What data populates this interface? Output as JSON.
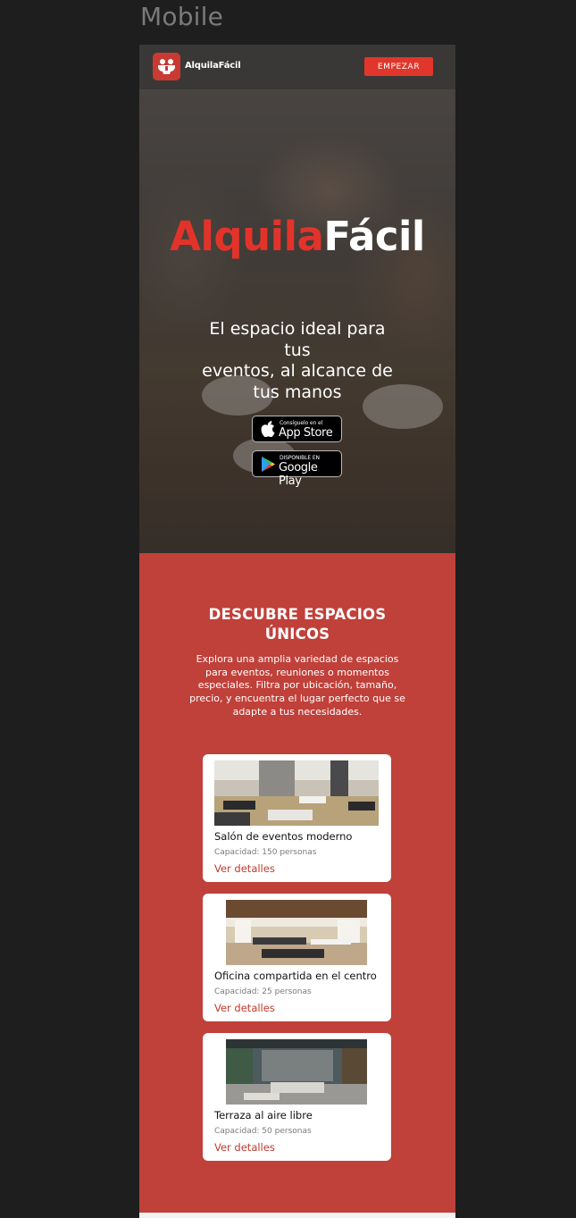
{
  "canvas": {
    "frame_label": "Mobile"
  },
  "nav": {
    "brand": "AlquilaFácil",
    "cta": "EMPEZAR"
  },
  "hero": {
    "title_part1": "Alquila",
    "title_part2": "Fácil",
    "subtitle_lines": [
      "El espacio ideal para",
      "tus",
      "eventos, al alcance de",
      "tus manos"
    ],
    "app_store": {
      "small": "Consíguelo en el",
      "big": "App Store"
    },
    "google_play": {
      "small": "DISPONIBLE EN",
      "big": "Google Play"
    }
  },
  "discover": {
    "title_lines": [
      "DESCUBRE ESPACIOS",
      "ÚNICOS"
    ],
    "text_lines": [
      "Explora una amplia variedad de espacios",
      "para eventos, reuniones o momentos",
      "especiales. Filtra por ubicación, tamaño,",
      "precio, y encuentra el lugar perfecto que se",
      "adapte a tus necesidades."
    ]
  },
  "cards": [
    {
      "name": "Salón de eventos moderno",
      "capacity": "Capacidad: 150 personas",
      "link": "Ver detalles"
    },
    {
      "name": "Oficina compartida en el centro",
      "capacity": "Capacidad: 25 personas",
      "link": "Ver detalles"
    },
    {
      "name": "Terraza al aire libre",
      "capacity": "Capacidad: 50 personas",
      "link": "Ver detalles"
    }
  ],
  "colors": {
    "brand_red": "#e2332a",
    "section_red": "#c0403a",
    "nav_bg": "#3a3836",
    "link_red": "#c0392b"
  }
}
